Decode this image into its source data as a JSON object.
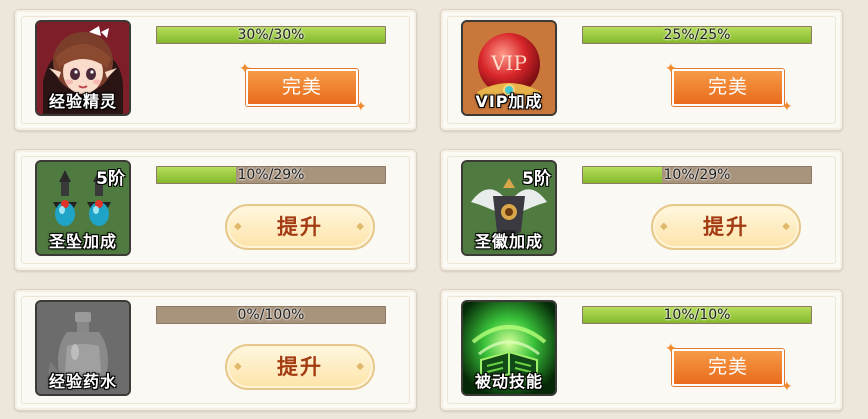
{
  "cards": [
    {
      "name": "经验精灵",
      "tier": "",
      "progress": "30%/30%",
      "progress_fraction": 1.0,
      "button": "完美",
      "button_kind": "perfect",
      "icon": "elf-girl-icon"
    },
    {
      "name": "VIP加成",
      "tier": "",
      "progress": "25%/25%",
      "progress_fraction": 1.0,
      "button": "完美",
      "button_kind": "perfect",
      "icon": "vip-orb-icon",
      "icon_text": "VIP"
    },
    {
      "name": "圣坠加成",
      "tier": "5阶",
      "progress": "10%/29%",
      "progress_fraction": 0.345,
      "button": "提升",
      "button_kind": "upgrade",
      "icon": "pendant-earrings-icon"
    },
    {
      "name": "圣徽加成",
      "tier": "5阶",
      "progress": "10%/29%",
      "progress_fraction": 0.345,
      "button": "提升",
      "button_kind": "upgrade",
      "icon": "winged-emblem-icon"
    },
    {
      "name": "经验药水",
      "tier": "",
      "progress": "0%/100%",
      "progress_fraction": 0.0,
      "button": "提升",
      "button_kind": "upgrade",
      "icon": "potion-bottle-icon"
    },
    {
      "name": "被动技能",
      "tier": "",
      "progress": "10%/10%",
      "progress_fraction": 1.0,
      "button": "完美",
      "button_kind": "perfect",
      "icon": "green-book-skill-icon"
    }
  ],
  "colors": {
    "bar_fill": "#9ccc42",
    "bar_empty": "#a8937c",
    "perfect_button": "#ee7b2a",
    "upgrade_text": "#a23a12"
  }
}
